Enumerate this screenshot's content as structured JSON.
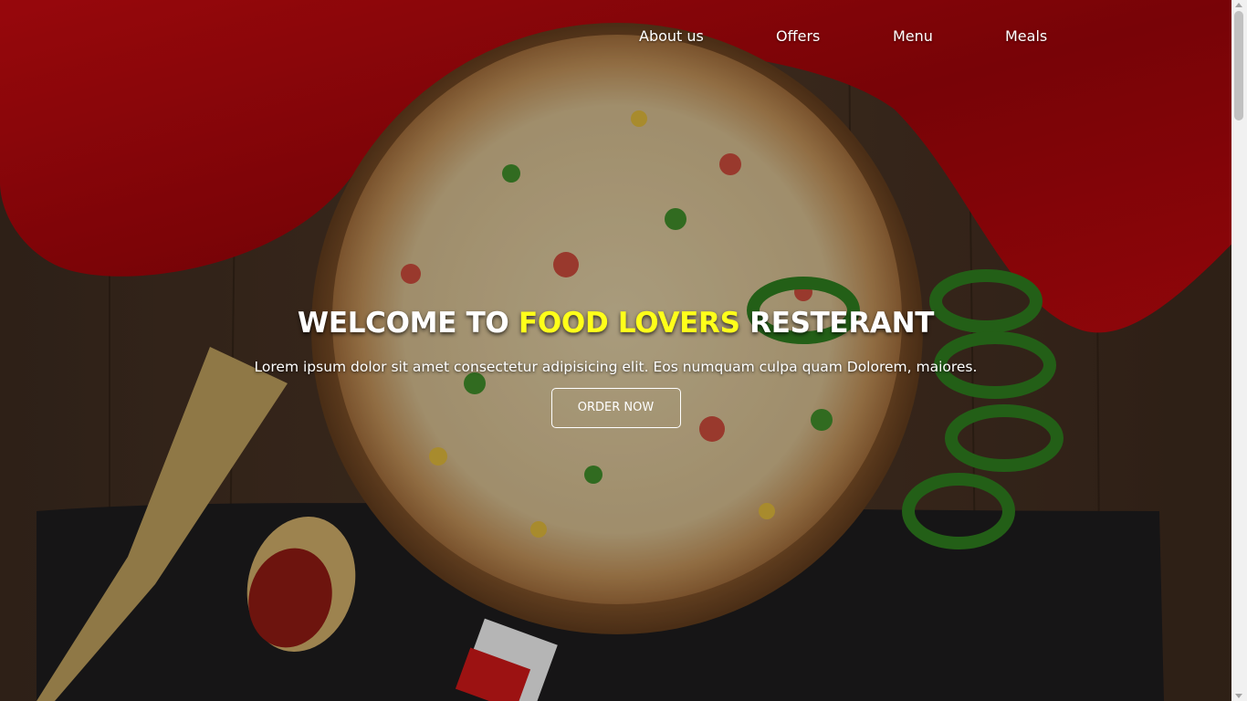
{
  "nav": {
    "items": [
      {
        "label": "About us"
      },
      {
        "label": "Offers"
      },
      {
        "label": "Menu"
      },
      {
        "label": "Meals"
      }
    ]
  },
  "hero": {
    "title_part1": "WELCOME TO ",
    "title_accent": "FOOD LOVERS",
    "title_part2": " RESTERANT",
    "subtitle": "Lorem ipsum dolor sit amet consectetur adipisicing elit. Eos numquam culpa quam Dolorem, maiores.",
    "button_label": "ORDER NOW"
  },
  "colors": {
    "accent": "#ffff1a",
    "text": "#ffffff",
    "cloth": "#b3080c",
    "table": "#5a3e2b"
  }
}
